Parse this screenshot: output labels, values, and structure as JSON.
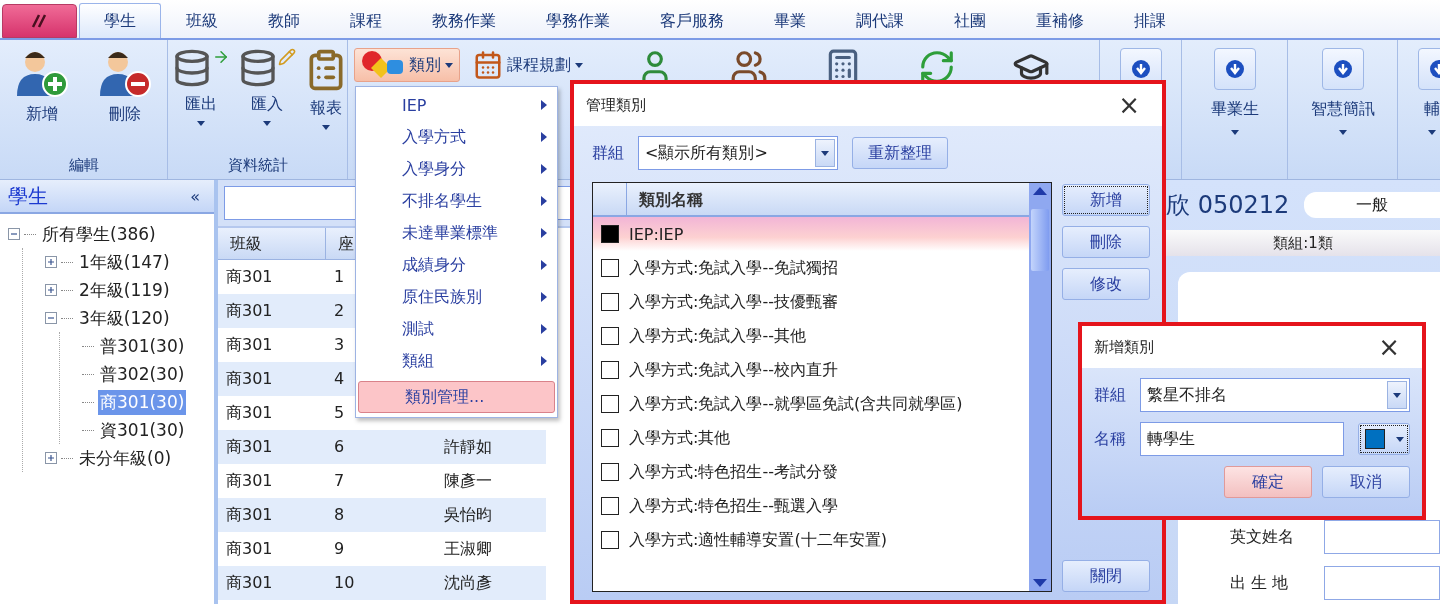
{
  "tabs": [
    {
      "label": "學生",
      "selected": true
    },
    {
      "label": "班級",
      "selected": false
    },
    {
      "label": "教師",
      "selected": false
    },
    {
      "label": "課程",
      "selected": false
    },
    {
      "label": "教務作業",
      "selected": false
    },
    {
      "label": "學務作業",
      "selected": false
    },
    {
      "label": "客戶服務",
      "selected": false
    },
    {
      "label": "畢業",
      "selected": false
    },
    {
      "label": "調代課",
      "selected": false
    },
    {
      "label": "社團",
      "selected": false
    },
    {
      "label": "重補修",
      "selected": false
    },
    {
      "label": "排課",
      "selected": false
    }
  ],
  "ribbon": {
    "groups": [
      {
        "label": "編輯",
        "buttons": [
          {
            "label": "新增",
            "dropdown": false
          },
          {
            "label": "刪除",
            "dropdown": false
          }
        ]
      },
      {
        "label": "資料統計",
        "buttons": [
          {
            "label": "匯出",
            "dropdown": true
          },
          {
            "label": "匯入",
            "dropdown": true
          },
          {
            "label": "報表",
            "dropdown": true
          }
        ]
      }
    ],
    "split_buttons": [
      {
        "label": "類別",
        "pressed": true
      },
      {
        "label": "課程規劃",
        "pressed": false
      }
    ],
    "right_buttons": [
      {
        "label": "畢業生"
      },
      {
        "label": "智慧簡訊"
      },
      {
        "label": "輔"
      }
    ]
  },
  "sidebar": {
    "title": "學生",
    "collapse": "«",
    "tree": [
      {
        "label": "所有學生(386)",
        "expanded": true,
        "selected": false,
        "children": [
          {
            "label": "1年級(147)",
            "expanded": false,
            "selected": false
          },
          {
            "label": "2年級(119)",
            "expanded": false,
            "selected": false
          },
          {
            "label": "3年級(120)",
            "expanded": true,
            "selected": false,
            "children": [
              {
                "label": "普301(30)",
                "selected": false
              },
              {
                "label": "普302(30)",
                "selected": false
              },
              {
                "label": "商301(30)",
                "selected": true
              },
              {
                "label": "資301(30)",
                "selected": false
              }
            ]
          },
          {
            "label": "未分年級(0)",
            "expanded": false,
            "selected": false
          }
        ]
      }
    ]
  },
  "table": {
    "columns": [
      "班級",
      "座"
    ],
    "rows": [
      {
        "class": "商301",
        "seat": "1"
      },
      {
        "class": "商301",
        "seat": "2"
      },
      {
        "class": "商301",
        "seat": "3"
      },
      {
        "class": "商301",
        "seat": "4"
      },
      {
        "class": "商301",
        "seat": "5"
      },
      {
        "class": "商301",
        "seat": "6",
        "name": "許靜如"
      },
      {
        "class": "商301",
        "seat": "7",
        "name": "陳彥一"
      },
      {
        "class": "商301",
        "seat": "8",
        "name": "吳怡昀"
      },
      {
        "class": "商301",
        "seat": "9",
        "name": "王淑卿"
      },
      {
        "class": "商301",
        "seat": "10",
        "name": "沈尚彥"
      }
    ]
  },
  "student": {
    "name": "欣 050212",
    "status": "一般",
    "group_bar": "類組:1類",
    "fields": [
      {
        "label": "英文姓名"
      },
      {
        "label": "出 生 地"
      }
    ]
  },
  "category_menu": {
    "items": [
      {
        "label": "IEP",
        "kind": "submenu",
        "selected": false
      },
      {
        "label": "入學方式",
        "kind": "submenu",
        "selected": false
      },
      {
        "label": "入學身分",
        "kind": "submenu",
        "selected": false
      },
      {
        "label": "不排名學生",
        "kind": "submenu",
        "selected": false
      },
      {
        "label": "未達畢業標準",
        "kind": "submenu",
        "selected": false
      },
      {
        "label": "成績身分",
        "kind": "submenu",
        "selected": false
      },
      {
        "label": "原住民族別",
        "kind": "submenu",
        "selected": false
      },
      {
        "label": "測試",
        "kind": "submenu",
        "selected": false
      },
      {
        "label": "類組",
        "kind": "submenu",
        "selected": false
      },
      {
        "label": "類別管理...",
        "kind": "action",
        "selected": true
      }
    ]
  },
  "manage_dialog": {
    "title": "管理類別",
    "close": "×",
    "group_label": "群組",
    "group_value": "<顯示所有類別>",
    "refresh_button": "重新整理",
    "list_header": "類別名稱",
    "items": [
      {
        "label": "IEP:IEP",
        "color": "#000000",
        "selected": true
      },
      {
        "label": "入學方式:免試入學--免試獨招",
        "color": "#ffffff",
        "selected": false
      },
      {
        "label": "入學方式:免試入學--技優甄審",
        "color": "#ffffff",
        "selected": false
      },
      {
        "label": "入學方式:免試入學--其他",
        "color": "#ffffff",
        "selected": false
      },
      {
        "label": "入學方式:免試入學--校內直升",
        "color": "#ffffff",
        "selected": false
      },
      {
        "label": "入學方式:免試入學--就學區免試(含共同就學區)",
        "color": "#ffffff",
        "selected": false
      },
      {
        "label": "入學方式:其他",
        "color": "#ffffff",
        "selected": false
      },
      {
        "label": "入學方式:特色招生--考試分發",
        "color": "#ffffff",
        "selected": false
      },
      {
        "label": "入學方式:特色招生--甄選入學",
        "color": "#ffffff",
        "selected": false
      },
      {
        "label": "入學方式:適性輔導安置(十二年安置)",
        "color": "#ffffff",
        "selected": false
      }
    ],
    "buttons": [
      {
        "label": "新增",
        "focused": true
      },
      {
        "label": "刪除",
        "focused": false
      },
      {
        "label": "修改",
        "focused": false
      }
    ],
    "close_button": "關閉"
  },
  "add_dialog": {
    "title": "新增類別",
    "close": "×",
    "group_label": "群組",
    "group_value": "繁星不排名",
    "name_label": "名稱",
    "name_value": "轉學生",
    "color": "#0070c0",
    "buttons": [
      {
        "label": "確定",
        "selected": true
      },
      {
        "label": "取消",
        "selected": false
      }
    ]
  }
}
